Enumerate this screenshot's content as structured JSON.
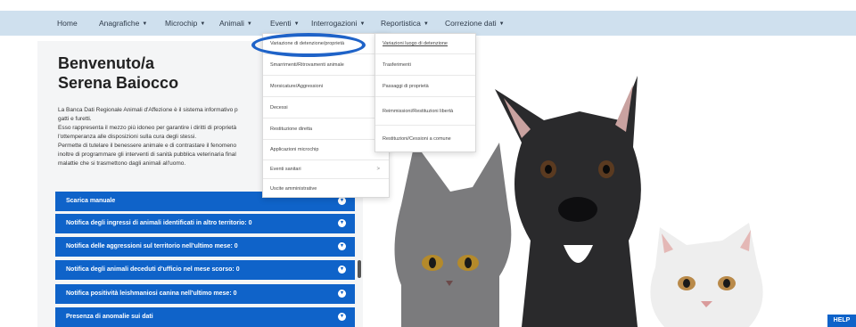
{
  "nav": {
    "items": [
      {
        "label": "Home",
        "caret": ""
      },
      {
        "label": "Anagrafiche",
        "caret": "▼"
      },
      {
        "label": "Microchip",
        "caret": "▼"
      },
      {
        "label": "Animali",
        "caret": "▼"
      },
      {
        "label": "Eventi",
        "caret": "▼"
      },
      {
        "label": "Interrogazioni",
        "caret": "▼"
      },
      {
        "label": "Reportistica",
        "caret": "▼"
      },
      {
        "label": "Correzione dati",
        "caret": "▼"
      }
    ]
  },
  "dropdown_left": {
    "items": [
      {
        "label": "Variazione di detenzione/proprietà",
        "sub": ""
      },
      {
        "label": "Smarrimenti/Ritrovamenti animale",
        "sub": ""
      },
      {
        "label": "Morsicature/Aggressioni",
        "sub": ""
      },
      {
        "label": "Decessi",
        "sub": ""
      },
      {
        "label": "Restituzione diretta",
        "sub": ""
      },
      {
        "label": "Applicazioni microchip",
        "sub": ""
      },
      {
        "label": "Eventi sanitari",
        "sub": ">"
      },
      {
        "label": "Uscite amministrative",
        "sub": ""
      }
    ]
  },
  "dropdown_right": {
    "items": [
      {
        "label": "Variazioni luogo di detenzione"
      },
      {
        "label": "Trasferimenti"
      },
      {
        "label": "Passaggi di proprietà"
      },
      {
        "label": "Reimmissioni/Restituzioni libertà"
      },
      {
        "label": "Restituzioni/Cessioni a comune"
      }
    ]
  },
  "welcome": {
    "line1": "Benvenuto/a",
    "line2": "Serena Baiocco"
  },
  "description": {
    "lines": [
      "La Banca Dati Regionale Animali d'Affezione è il sistema informativo p",
      "gatti e furetti.",
      "Esso rappresenta il mezzo più idoneo per garantire i diritti di proprietà",
      "l'ottemperanza alle disposizioni sulla cura degli stessi.",
      "Permette di tutelare il benessere animale e di contrastare il fenomeno",
      "inoltre di programmare gli interventi di sanità pubblica veterinaria final",
      "malattie che si trasmettono dagli animali all'uomo."
    ]
  },
  "bars": [
    {
      "label": "Scarica manuale"
    },
    {
      "label": "Notifica degli ingressi di animali identificati in altro territorio: 0"
    },
    {
      "label": "Notifica delle aggressioni sul territorio nell'ultimo mese: 0"
    },
    {
      "label": "Notifica degli animali deceduti d'ufficio nel mese scorso: 0"
    },
    {
      "label": "Notifica positività leishmaniosi canina nell'ultimo mese: 0"
    },
    {
      "label": "Presenza di anomalie sui dati"
    }
  ],
  "help": {
    "label": "HELP"
  },
  "colors": {
    "nav_bg": "#cfe0ee",
    "bar_blue": "#0f63c9",
    "highlight": "#1f63c8"
  }
}
